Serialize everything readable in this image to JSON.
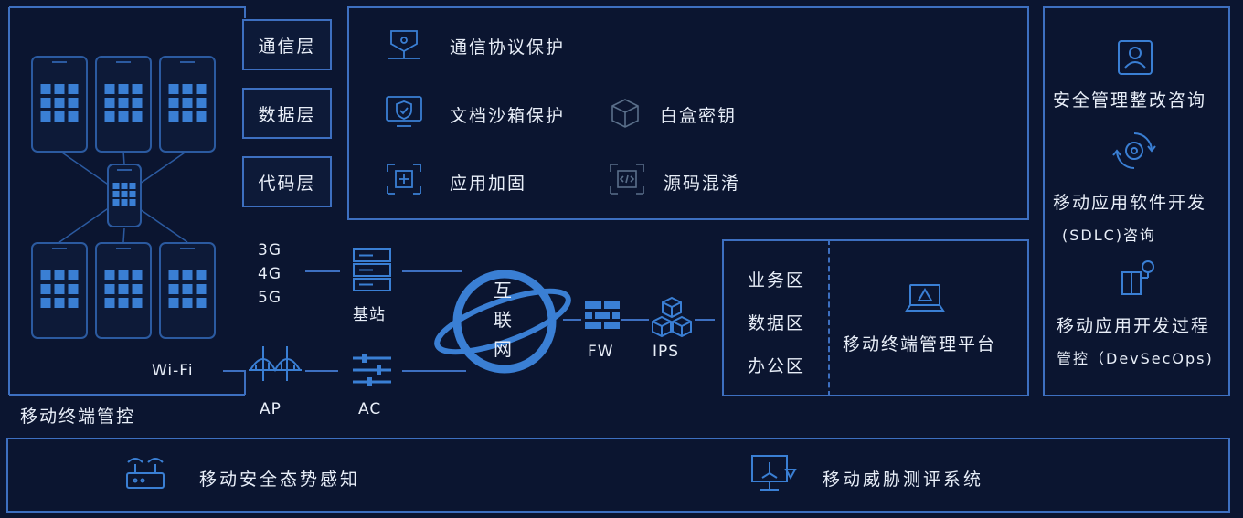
{
  "colors": {
    "background": "#0b1530",
    "accent": "#3d6fc0",
    "icon": "#3a7fd4",
    "text": "#e8eef8"
  },
  "terminal_panel": {
    "label": "移动终端管控",
    "layers": [
      "通信层",
      "数据层",
      "代码层"
    ]
  },
  "protections": {
    "items": [
      {
        "label": "通信协议保护",
        "icon": "network-shield-icon"
      },
      {
        "label": "文档沙箱保护",
        "icon": "monitor-shield-icon"
      },
      {
        "label": "白盒密钥",
        "icon": "cube-icon"
      },
      {
        "label": "应用加固",
        "icon": "plus-frame-icon"
      },
      {
        "label": "源码混淆",
        "icon": "code-frame-icon"
      }
    ]
  },
  "network": {
    "cellular": [
      "3G",
      "4G",
      "5G"
    ],
    "base_station": "基站",
    "wifi": "Wi-Fi",
    "ap": "AP",
    "ac": "AC",
    "internet": [
      "互",
      "联",
      "网"
    ],
    "fw": "FW",
    "ips": "IPS"
  },
  "zones": {
    "items": [
      "业务区",
      "数据区",
      "办公区"
    ],
    "platform": "移动终端管理平台"
  },
  "services": {
    "items": [
      {
        "lines": [
          "安全管理整改咨询"
        ],
        "icon": "badge-icon"
      },
      {
        "lines": [
          "移动应用软件开发",
          "(SDLC)咨询"
        ],
        "icon": "gear-cycle-icon"
      },
      {
        "lines": [
          "移动应用开发过程",
          "管控（DevSecOps)"
        ],
        "icon": "pipeline-icon"
      }
    ]
  },
  "bottom_bar": {
    "left": "移动安全态势感知",
    "right": "移动威胁测评系统"
  }
}
